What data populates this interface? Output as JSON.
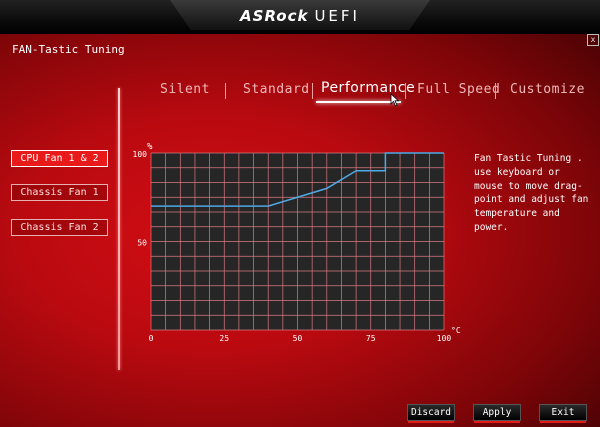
{
  "header": {
    "brand": "ASRock",
    "product": "UEFI"
  },
  "window": {
    "close_label": "x"
  },
  "page": {
    "title": "FAN-Tastic Tuning"
  },
  "tabs": [
    {
      "label": "Silent",
      "active": false
    },
    {
      "label": "Standard",
      "active": false
    },
    {
      "label": "Performance",
      "active": true
    },
    {
      "label": "Full Speed",
      "active": false
    },
    {
      "label": "Customize",
      "active": false
    }
  ],
  "fans": [
    {
      "label": "CPU Fan 1 & 2",
      "active": true
    },
    {
      "label": "Chassis Fan 1",
      "active": false
    },
    {
      "label": "Chassis Fan 2",
      "active": false
    }
  ],
  "help_text": "Fan Tastic Tuning . use keyboard or mouse to move drag-point and adjust fan temperature and power.",
  "buttons": {
    "discard": "Discard",
    "apply": "Apply",
    "exit": "Exit"
  },
  "chart_data": {
    "type": "line",
    "ylabel": "%",
    "xlabel": "°C",
    "xlim": [
      0,
      100
    ],
    "ylim": [
      0,
      100
    ],
    "x_ticks": [
      "0",
      "25",
      "50",
      "75",
      "100"
    ],
    "y_ticks": [
      "100",
      "50"
    ],
    "grid": true,
    "series": [
      {
        "points": [
          [
            0,
            70
          ],
          [
            40,
            70
          ],
          [
            60,
            80
          ],
          [
            70,
            90
          ],
          [
            80,
            90
          ],
          [
            80,
            100
          ],
          [
            100,
            100
          ]
        ]
      }
    ],
    "colors": {
      "plot_bg": "#262626",
      "grid": "#d97a82",
      "line": "#4ea9e6"
    }
  }
}
